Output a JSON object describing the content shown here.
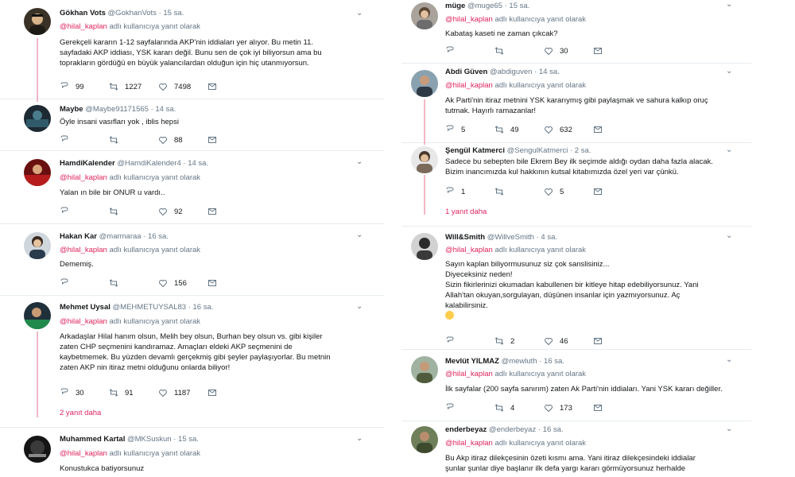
{
  "reply_prefix": "adlı kullanıcıya yanıt olarak",
  "left": [
    {
      "name": "Gökhan Vots",
      "handle": "@GokhanVots",
      "time": "· 15 sa.",
      "replying_to": "@hilal_kaplan",
      "lines": [
        "Gerekçeli kararın 1-12 sayfalarında AKP'nin iddiaları yer alıyor. Bu metin 11.",
        "sayfadaki AKP iddiası, YSK kararı değil. Bunu sen de çok iyi biliyorsun ama bu",
        "toprakların gördüğü en büyük yalancılardan olduğun için hiç utanmıyorsun."
      ],
      "reply_count": "99",
      "retweet_count": "1227",
      "like_count": "7498"
    },
    {
      "name": "Maybe",
      "handle": "@Maybe91171565",
      "time": "· 14 sa.",
      "replying_to": "",
      "lines": [
        "Öyle insani vasıfları yok , iblis hepsi"
      ],
      "reply_count": "",
      "retweet_count": "",
      "like_count": "88"
    },
    {
      "name": "HamdiKalender",
      "handle": "@HamdiKalender4",
      "time": "· 14 sa.",
      "replying_to": "@hilal_kaplan",
      "lines": [
        "Yalan ın bile bir ONUR u vardı.."
      ],
      "reply_count": "",
      "retweet_count": "",
      "like_count": "92"
    },
    {
      "name": "Hakan Kar",
      "handle": "@marmaraa",
      "time": "· 16 sa.",
      "replying_to": "@hilal_kaplan",
      "lines": [
        "Dememiş."
      ],
      "reply_count": "",
      "retweet_count": "",
      "like_count": "156"
    },
    {
      "name": "Mehmet Uysal",
      "handle": "@MEHMETUYSAL83",
      "time": "· 16 sa.",
      "replying_to": "@hilal_kaplan",
      "lines": [
        "Arkadaşlar Hilal hanım olsun, Melih bey olsun, Burhan bey olsun vs. gibi kişiler",
        "zaten CHP seçmenini kandıramaz. Amaçları eldeki AKP seçmenini de",
        "kaybetmemek. Bu yüzden devamlı gerçekmiş gibi şeyler paylaşıyorlar. Bu metnin",
        "zaten AKP nin itiraz metni olduğunu onlarda biliyor!"
      ],
      "reply_count": "30",
      "retweet_count": "91",
      "like_count": "1187",
      "more_replies": "2 yanıt daha"
    },
    {
      "name": "Muhammed Kartal",
      "handle": "@MKSuskun",
      "time": "· 15 sa.",
      "replying_to": "@hilal_kaplan",
      "lines": [
        "Konustukca batiyorsunuz"
      ]
    }
  ],
  "right": [
    {
      "name": "müge",
      "handle": "@muge65",
      "time": "· 15 sa.",
      "replying_to": "@hilal_kaplan",
      "lines": [
        "Kabataş kaseti ne zaman çıkcak?"
      ],
      "reply_count": "",
      "retweet_count": "",
      "like_count": "30"
    },
    {
      "name": "Abdi Güven",
      "handle": "@abdiguven",
      "time": "· 14 sa.",
      "replying_to": "@hilal_kaplan",
      "lines": [
        "Ak Parti'nin itiraz metnini YSK kararıymış gibi paylaşmak ve sahura kalkıp oruç",
        "tutmak. Hayırlı ramazanlar!"
      ],
      "reply_count": "5",
      "retweet_count": "49",
      "like_count": "632"
    },
    {
      "name": "Şengül Katmerci",
      "handle": "@SengulKatmerci",
      "time": "· 2 sa.",
      "replying_to": "",
      "lines": [
        "Sadece bu sebepten bile Ekrem Bey ilk seçimde aldığı oydan daha fazla alacak.",
        "Bizim inancımızda kul hakkının kutsal kitabımızda özel yeri var çünkü."
      ],
      "reply_count": "1",
      "retweet_count": "",
      "like_count": "5",
      "more_replies": "1 yanıt daha"
    },
    {
      "name": "Will&Smith",
      "handle": "@WillveSmith",
      "time": "· 4 sa.",
      "replying_to": "@hilal_kaplan",
      "lines": [
        "Sayın kaplan biliyormusunuz siz çok sanslisiniz...",
        "Diyeceksiniz neden!",
        "Sizin fikirlerinizi okumadan kabullenen bir kitleye hitap edebiliyorsunuz. Yani",
        "Allah'tan okuyan,sorgulayan, düşünen insanlar için yazmıyorsunuz. Aç",
        "kalabilirsiniz."
      ],
      "reply_count": "",
      "retweet_count": "2",
      "like_count": "46"
    },
    {
      "name": "Mevlüt YILMAZ",
      "handle": "@mewluth",
      "time": "· 16 sa.",
      "replying_to": "@hilal_kaplan",
      "lines": [
        "İlk sayfalar (200 sayfa sanırım) zaten Ak Parti'nin iddiaları. Yani YSK kararı değiller."
      ],
      "reply_count": "",
      "retweet_count": "4",
      "like_count": "173"
    },
    {
      "name": "enderbeyaz",
      "handle": "@enderbeyaz",
      "time": "· 16 sa.",
      "replying_to": "@hilal_kaplan",
      "lines": [
        "Bu Akp itiraz dilekçesinin özeti kısmı  ama. Yani itiraz dilekçesindeki iddialar",
        "şunlar şunlar diye başlanır ilk defa yargı kararı görmüyorsunuz herhalde"
      ]
    }
  ],
  "colors": {
    "mention": "#e0245e",
    "muted": "#657786",
    "thread": "#f2b6c6",
    "divider": "#e6ecf0"
  },
  "icons": [
    "reply-icon",
    "retweet-icon",
    "like-icon",
    "message-icon",
    "chevron-down-icon"
  ]
}
